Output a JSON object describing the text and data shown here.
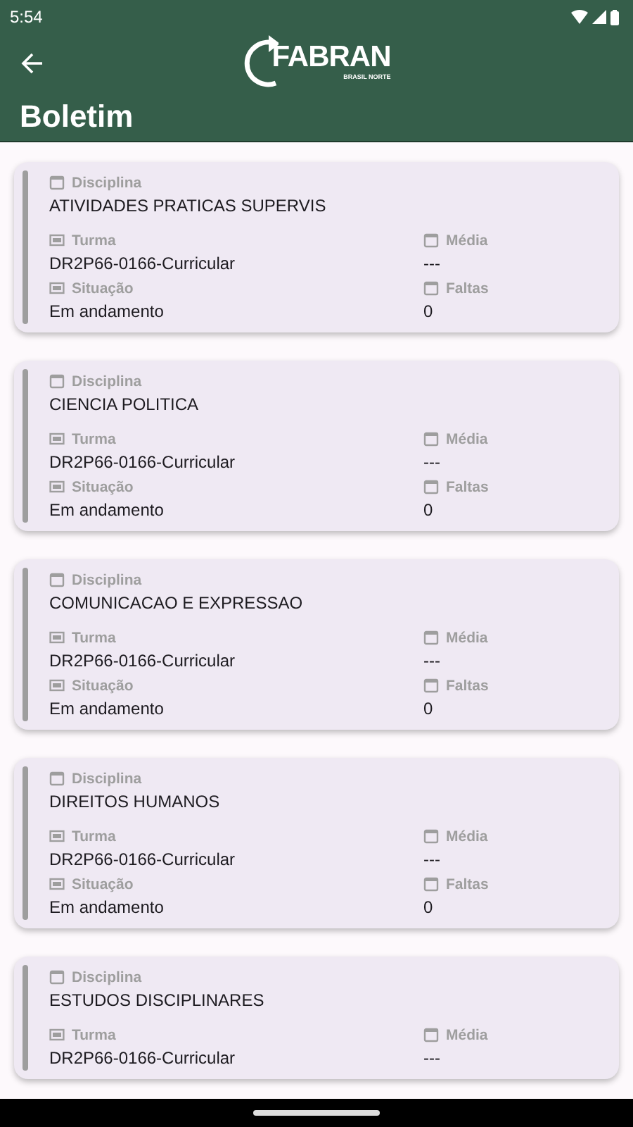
{
  "status_bar": {
    "time": "5:54"
  },
  "app_bar": {
    "logo_text": "FABRAN",
    "logo_subtext": "BRASIL NORTE",
    "title": "Boletim"
  },
  "cards": [
    {
      "disciplina_label": "Disciplina",
      "disciplina": "ATIVIDADES PRATICAS SUPERVIS",
      "turma_label": "Turma",
      "turma": "DR2P66-0166-Curricular",
      "media_label": "Média",
      "media": "---",
      "situacao_label": "Situação",
      "situacao": "Em andamento",
      "faltas_label": "Faltas",
      "faltas": "0"
    },
    {
      "disciplina_label": "Disciplina",
      "disciplina": "CIENCIA POLITICA",
      "turma_label": "Turma",
      "turma": "DR2P66-0166-Curricular",
      "media_label": "Média",
      "media": "---",
      "situacao_label": "Situação",
      "situacao": "Em andamento",
      "faltas_label": "Faltas",
      "faltas": "0"
    },
    {
      "disciplina_label": "Disciplina",
      "disciplina": "COMUNICACAO E EXPRESSAO",
      "turma_label": "Turma",
      "turma": "DR2P66-0166-Curricular",
      "media_label": "Média",
      "media": "---",
      "situacao_label": "Situação",
      "situacao": "Em andamento",
      "faltas_label": "Faltas",
      "faltas": "0"
    },
    {
      "disciplina_label": "Disciplina",
      "disciplina": "DIREITOS HUMANOS",
      "turma_label": "Turma",
      "turma": "DR2P66-0166-Curricular",
      "media_label": "Média",
      "media": "---",
      "situacao_label": "Situação",
      "situacao": "Em andamento",
      "faltas_label": "Faltas",
      "faltas": "0"
    },
    {
      "disciplina_label": "Disciplina",
      "disciplina": "ESTUDOS DISCIPLINARES",
      "turma_label": "Turma",
      "turma": "DR2P66-0166-Curricular",
      "media_label": "Média",
      "media": "---"
    }
  ]
}
